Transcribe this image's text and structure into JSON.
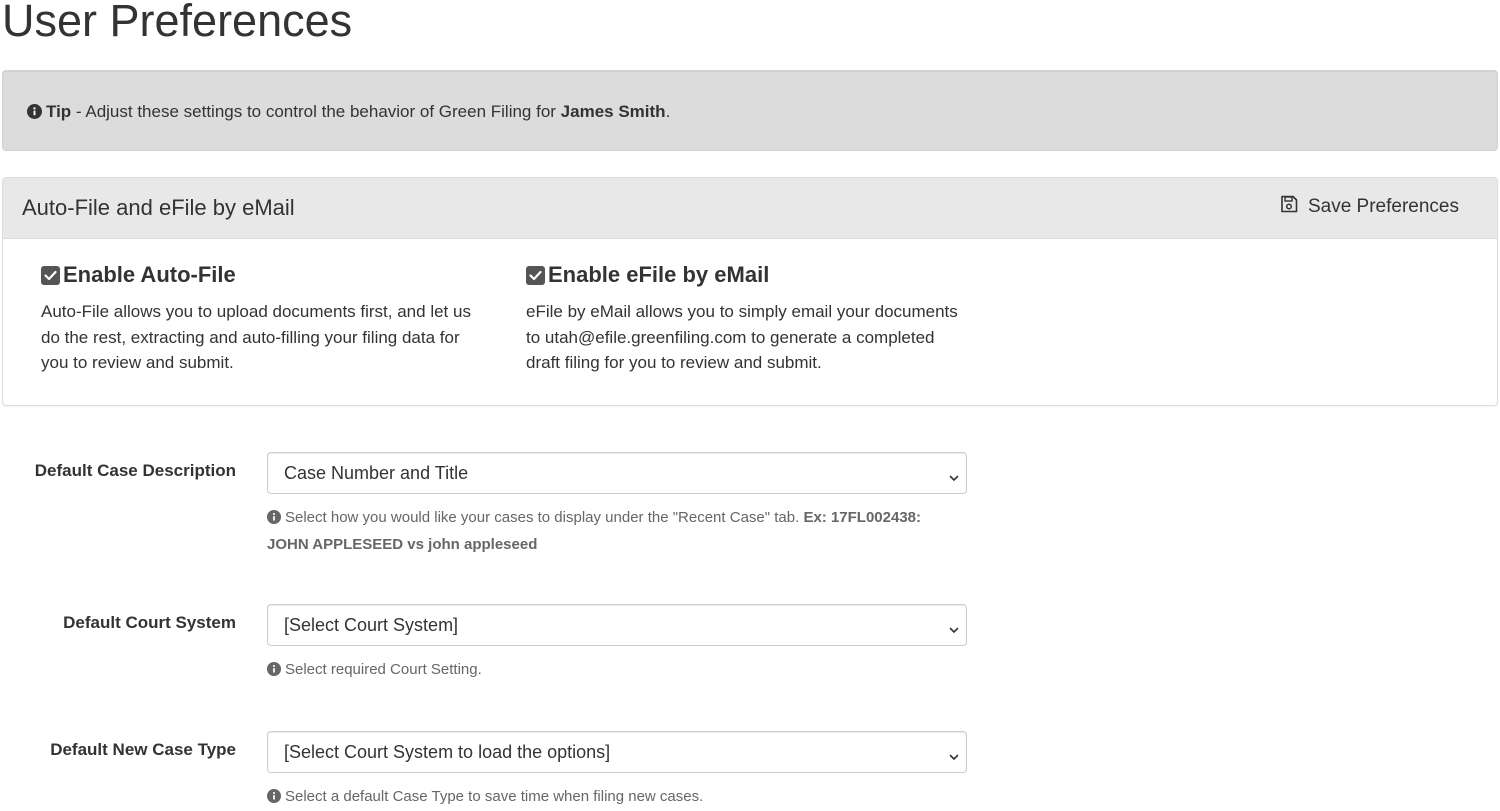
{
  "page": {
    "title": "User Preferences"
  },
  "tip": {
    "label": "Tip",
    "text_before": " - Adjust these settings to control the behavior of Green Filing for ",
    "user_name": "James Smith",
    "text_after": "."
  },
  "panel": {
    "title": "Auto-File and eFile by eMail",
    "save_label": "Save Preferences",
    "features": [
      {
        "title": "Enable Auto-File",
        "checked": true,
        "description": "Auto-File allows you to upload documents first, and let us do the rest, extracting and auto-filling your filing data for you to review and submit."
      },
      {
        "title": "Enable eFile by eMail",
        "checked": true,
        "description": "eFile by eMail allows you to simply email your documents to utah@efile.greenfiling.com to generate a completed draft filing for you to review and submit."
      }
    ]
  },
  "form": {
    "case_description": {
      "label": "Default Case Description",
      "value": "Case Number and Title",
      "help": "Select how you would like your cases to display under the \"Recent Case\" tab. ",
      "help_example": "Ex: 17FL002438: JOHN APPLESEED vs john appleseed"
    },
    "court_system": {
      "label": "Default Court System",
      "value": "[Select Court System]",
      "help": "Select required Court Setting."
    },
    "new_case_type": {
      "label": "Default New Case Type",
      "value": "[Select Court System to load the options]",
      "help": "Select a default Case Type to save time when filing new cases."
    }
  },
  "icons": {
    "info": "info-circle-icon",
    "save": "floppy-disk-icon",
    "checkbox": "checkbox-checked-icon",
    "chevron": "chevron-down-icon"
  },
  "colors": {
    "tip_background": "#dcdcdc",
    "panel_heading": "#e8e8e8",
    "checkbox": "#555555",
    "help_text": "#666666"
  }
}
